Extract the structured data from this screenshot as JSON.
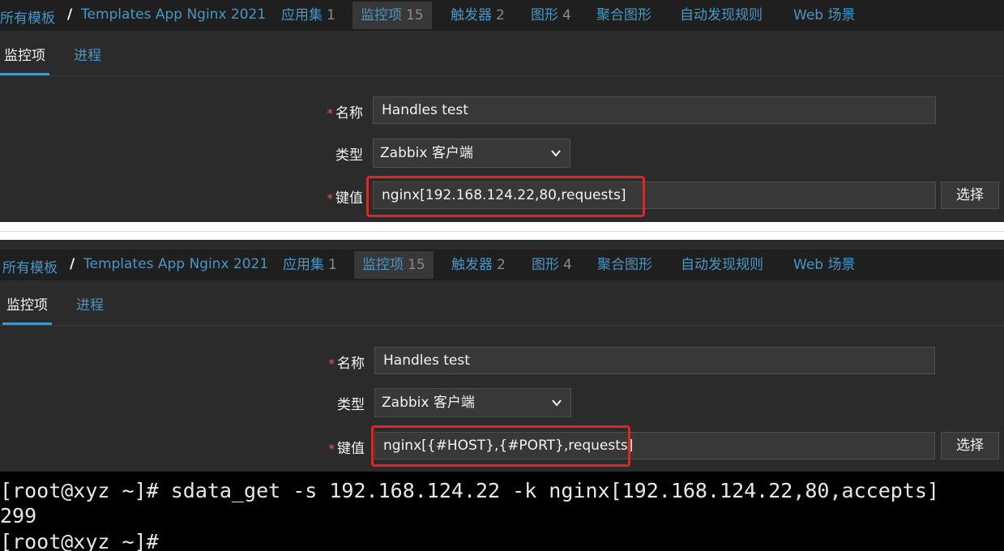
{
  "panels": [
    {
      "breadcrumb": {
        "all_templates": "所有模板",
        "separator": "/",
        "template_name": "Templates App Nginx 2021"
      },
      "tabs": [
        {
          "label": "应用集",
          "count": "1"
        },
        {
          "label": "监控项",
          "count": "15"
        },
        {
          "label": "触发器",
          "count": "2"
        },
        {
          "label": "图形",
          "count": "4"
        },
        {
          "label": "聚合图形",
          "count": ""
        },
        {
          "label": "自动发现规则",
          "count": ""
        },
        {
          "label": "Web 场景",
          "count": ""
        }
      ],
      "subtabs": [
        "监控项",
        "进程"
      ],
      "form": {
        "name_label": "名称",
        "name_value": "Handles test",
        "type_label": "类型",
        "type_value": "Zabbix 客户端",
        "key_label": "键值",
        "key_value": "nginx[192.168.124.22,80,requests]",
        "select_button": "选择",
        "required_mark": "*"
      }
    },
    {
      "breadcrumb": {
        "all_templates": "所有模板",
        "separator": "/",
        "template_name": "Templates App Nginx 2021"
      },
      "tabs": [
        {
          "label": "应用集",
          "count": "1"
        },
        {
          "label": "监控项",
          "count": "15"
        },
        {
          "label": "触发器",
          "count": "2"
        },
        {
          "label": "图形",
          "count": "4"
        },
        {
          "label": "聚合图形",
          "count": ""
        },
        {
          "label": "自动发现规则",
          "count": ""
        },
        {
          "label": "Web 场景",
          "count": ""
        }
      ],
      "subtabs": [
        "监控项",
        "进程"
      ],
      "form": {
        "name_label": "名称",
        "name_value": "Handles test",
        "type_label": "类型",
        "type_value": "Zabbix 客户端",
        "key_label": "键值",
        "key_value": "nginx[{#HOST},{#PORT},requests]",
        "select_button": "选择",
        "required_mark": "*"
      }
    }
  ],
  "terminal": {
    "lines": [
      "[root@xyz ~]# sdata_get -s 192.168.124.22 -k nginx[192.168.124.22,80,accepts]",
      "299",
      "[root@xyz ~]#"
    ]
  },
  "colors": {
    "link": "#4796c4",
    "background": "#2b2b2b",
    "highlight": "#e8231f",
    "required": "#e45959"
  }
}
